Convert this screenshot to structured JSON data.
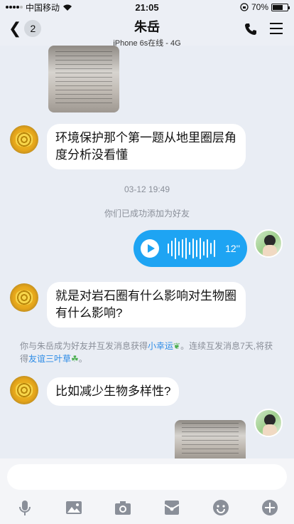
{
  "status_bar": {
    "carrier": "中国移动",
    "time": "21:05",
    "battery": "70%",
    "battery_level": 0.7
  },
  "header": {
    "back_count": "2",
    "title": "朱岳",
    "subtitle": "iPhone 6s在线 - 4G"
  },
  "messages": {
    "msg1": "环境保护那个第一题从地里圈层角度分析没看懂",
    "timestamp": "03-12 19:49",
    "added_friend": "你们已成功添加为好友",
    "voice_duration": "12''",
    "msg2": "就是对岩石圈有什么影响对生物圈有什么影响?",
    "friend_notice_prefix": "你与朱岳成为好友并互发消息获得",
    "friend_notice_link1": "小幸运",
    "friend_notice_mid": "。连续互发消息7天,将获得",
    "friend_notice_link2": "友谊三叶草",
    "friend_notice_suffix": "。",
    "msg3": "比如减少生物多样性?"
  },
  "toolbar": {
    "icons": [
      "microphone-icon",
      "image-icon",
      "camera-icon",
      "red-packet-icon",
      "emoji-icon",
      "plus-icon"
    ]
  },
  "colors": {
    "accent": "#1ea4f3",
    "link": "#2d8ce6",
    "background": "#e9edf4"
  }
}
